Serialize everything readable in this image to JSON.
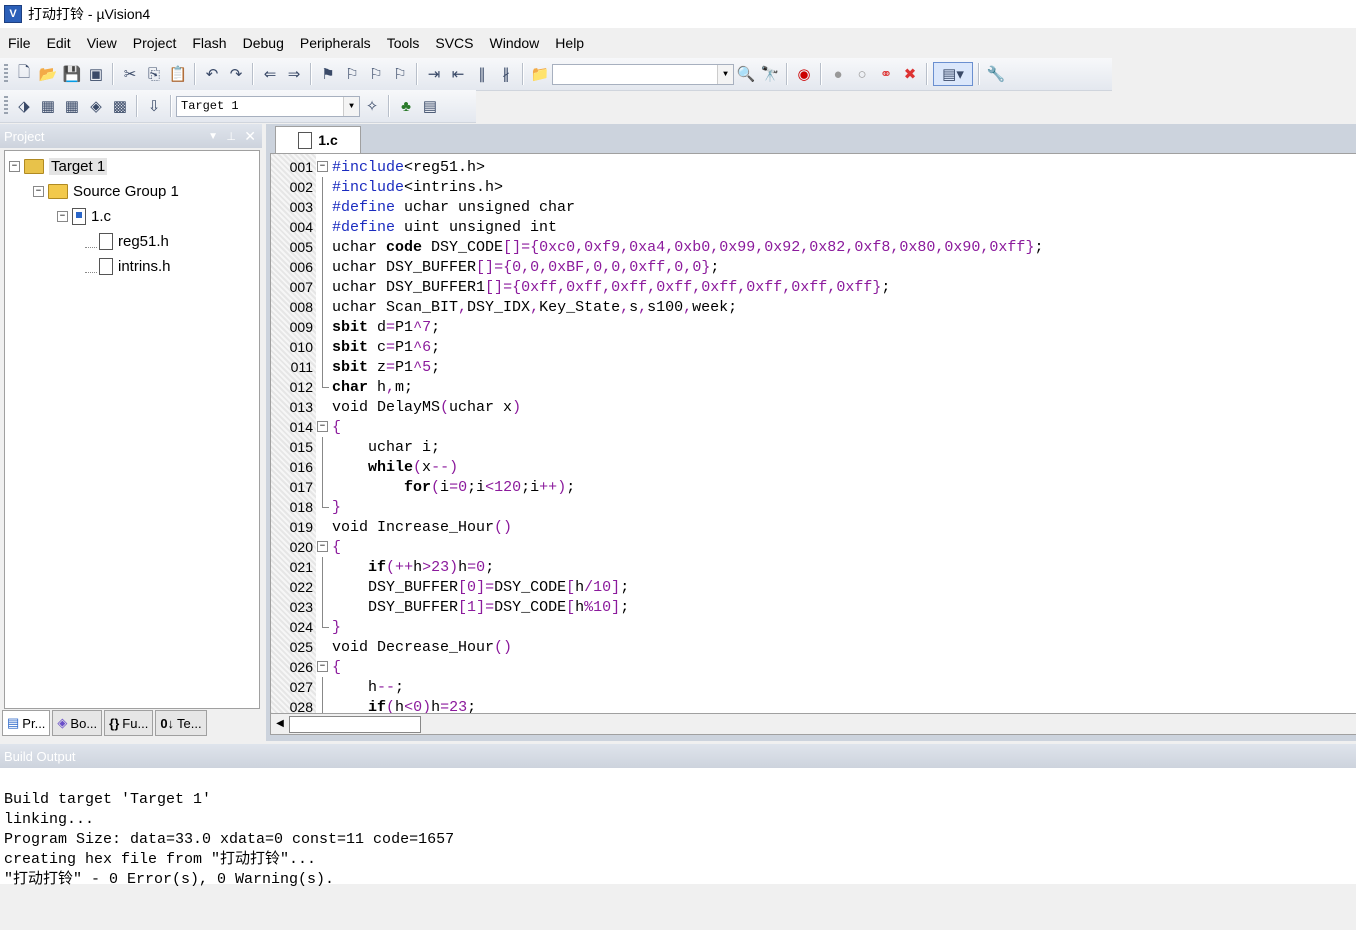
{
  "window": {
    "title": "打动打铃  - µVision4",
    "app_icon": "uvision-icon"
  },
  "menu": [
    {
      "label": "File"
    },
    {
      "label": "Edit"
    },
    {
      "label": "View"
    },
    {
      "label": "Project"
    },
    {
      "label": "Flash"
    },
    {
      "label": "Debug"
    },
    {
      "label": "Peripherals"
    },
    {
      "label": "Tools"
    },
    {
      "label": "SVCS"
    },
    {
      "label": "Window"
    },
    {
      "label": "Help"
    }
  ],
  "toolbar2": {
    "target_select": "Target 1"
  },
  "project_panel": {
    "title": "Project",
    "tree": [
      {
        "label": "Target 1",
        "icon": "target-folder-icon"
      },
      {
        "label": "Source Group 1",
        "icon": "folder-icon"
      },
      {
        "label": "1.c",
        "icon": "c-file-icon"
      },
      {
        "label": "reg51.h",
        "icon": "header-file-icon"
      },
      {
        "label": "intrins.h",
        "icon": "header-file-icon"
      }
    ],
    "tabs": [
      {
        "label": "Pr..."
      },
      {
        "label": "Bo..."
      },
      {
        "label": "Fu..."
      },
      {
        "label": "Te..."
      }
    ]
  },
  "editor": {
    "tab": "1.c",
    "lines": [
      {
        "n": "001",
        "t": "#include<reg51.h>"
      },
      {
        "n": "002",
        "t": "#include<intrins.h>"
      },
      {
        "n": "003",
        "t": "#define uchar unsigned char"
      },
      {
        "n": "004",
        "t": "#define uint unsigned int"
      },
      {
        "n": "005",
        "t": "uchar code DSY_CODE[]={0xc0,0xf9,0xa4,0xb0,0x99,0x92,0x82,0xf8,0x80,0x90,0xff};"
      },
      {
        "n": "006",
        "t": "uchar DSY_BUFFER[]={0,0,0xBF,0,0,0xff,0,0};"
      },
      {
        "n": "007",
        "t": "uchar DSY_BUFFER1[]={0xff,0xff,0xff,0xff,0xff,0xff,0xff,0xff};"
      },
      {
        "n": "008",
        "t": "uchar Scan_BIT,DSY_IDX,Key_State,s,s100,week;"
      },
      {
        "n": "009",
        "t": "sbit d=P1^7;"
      },
      {
        "n": "010",
        "t": "sbit c=P1^6;"
      },
      {
        "n": "011",
        "t": "sbit z=P1^5;"
      },
      {
        "n": "012",
        "t": "char h,m;"
      },
      {
        "n": "013",
        "t": "void DelayMS(uchar x)"
      },
      {
        "n": "014",
        "t": "{"
      },
      {
        "n": "015",
        "t": "    uchar i;"
      },
      {
        "n": "016",
        "t": "    while(x--)"
      },
      {
        "n": "017",
        "t": "        for(i=0;i<120;i++);"
      },
      {
        "n": "018",
        "t": "}"
      },
      {
        "n": "019",
        "t": "void Increase_Hour()"
      },
      {
        "n": "020",
        "t": "{"
      },
      {
        "n": "021",
        "t": "    if(++h>23)h=0;"
      },
      {
        "n": "022",
        "t": "    DSY_BUFFER[0]=DSY_CODE[h/10];"
      },
      {
        "n": "023",
        "t": "    DSY_BUFFER[1]=DSY_CODE[h%10];"
      },
      {
        "n": "024",
        "t": "}"
      },
      {
        "n": "025",
        "t": "void Decrease_Hour()"
      },
      {
        "n": "026",
        "t": "{"
      },
      {
        "n": "027",
        "t": "    h--;"
      },
      {
        "n": "028",
        "t": "    if(h<0)h=23;"
      }
    ]
  },
  "build_output": {
    "title": "Build Output",
    "lines": [
      "Build target 'Target 1'",
      "linking...",
      "Program Size: data=33.0 xdata=0 const=11 code=1657",
      "creating hex file from \"打动打铃\"...",
      "\"打动打铃\" - 0 Error(s), 0 Warning(s)."
    ]
  }
}
